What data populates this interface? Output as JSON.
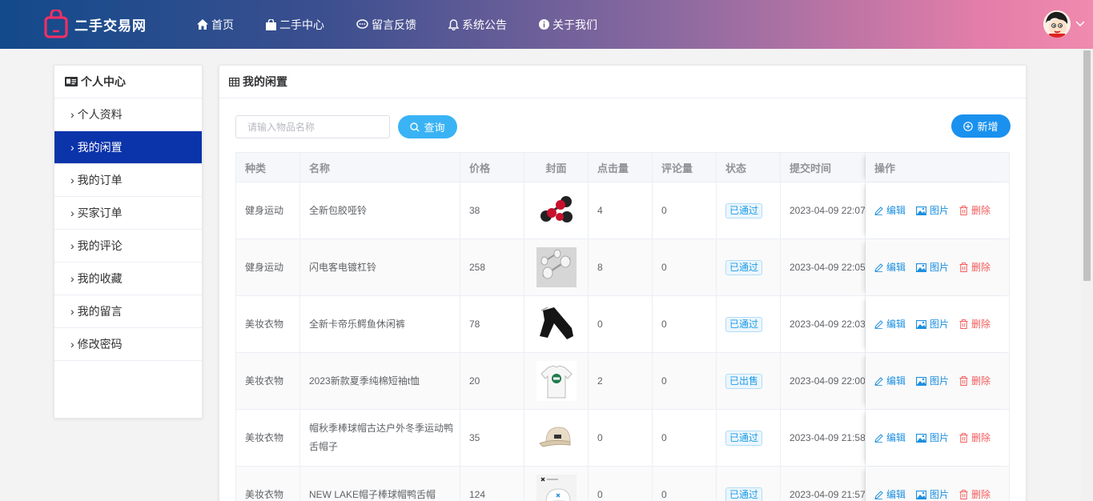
{
  "header": {
    "site_name": "二手交易网",
    "nav": [
      {
        "label": "首页",
        "icon": "home-icon"
      },
      {
        "label": "二手中心",
        "icon": "shopping-bag-icon"
      },
      {
        "label": "留言反馈",
        "icon": "comment-icon"
      },
      {
        "label": "系统公告",
        "icon": "bell-icon"
      },
      {
        "label": "关于我们",
        "icon": "info-icon"
      }
    ]
  },
  "sidebar": {
    "title": "个人中心",
    "items": [
      {
        "label": "个人资料"
      },
      {
        "label": "我的闲置",
        "active": true
      },
      {
        "label": "我的订单"
      },
      {
        "label": "买家订单"
      },
      {
        "label": "我的评论"
      },
      {
        "label": "我的收藏"
      },
      {
        "label": "我的留言"
      },
      {
        "label": "修改密码"
      }
    ]
  },
  "main": {
    "title": "我的闲置",
    "search_placeholder": "请输入物品名称",
    "search_value": "",
    "query_label": "查询",
    "add_label": "新增"
  },
  "table": {
    "columns": [
      "种类",
      "名称",
      "价格",
      "封面",
      "点击量",
      "评论量",
      "状态",
      "提交时间",
      "操作"
    ],
    "rows": [
      {
        "category": "健身运动",
        "name": "全新包胶哑铃",
        "price": "38",
        "cover": "dumbbell",
        "clicks": "4",
        "comments": "0",
        "status": "已通过",
        "time": "2023-04-09 22:07"
      },
      {
        "category": "健身运动",
        "name": "闪电客电镀杠铃",
        "price": "258",
        "cover": "barbell",
        "clicks": "8",
        "comments": "0",
        "status": "已通过",
        "time": "2023-04-09 22:05"
      },
      {
        "category": "美妆衣物",
        "name": "全新卡帝乐鳄鱼休闲裤",
        "price": "78",
        "cover": "pants",
        "clicks": "0",
        "comments": "0",
        "status": "已通过",
        "time": "2023-04-09 22:03"
      },
      {
        "category": "美妆衣物",
        "name": "2023新款夏季纯棉短袖t恤",
        "price": "20",
        "cover": "tshirt",
        "clicks": "2",
        "comments": "0",
        "status": "已出售",
        "time": "2023-04-09 22:00"
      },
      {
        "category": "美妆衣物",
        "name": "帽秋季棒球帽古达户外冬季运动鸭舌帽子",
        "price": "35",
        "cover": "cap",
        "clicks": "0",
        "comments": "0",
        "status": "已通过",
        "time": "2023-04-09 21:58"
      },
      {
        "category": "美妆衣物",
        "name": "NEW LAKE帽子棒球帽鸭舌帽",
        "price": "124",
        "cover": "white-cap",
        "clicks": "0",
        "comments": "0",
        "status": "已通过",
        "time": "2023-04-09 21:57"
      }
    ],
    "actions": {
      "edit": "编辑",
      "picture": "图片",
      "delete": "删除"
    }
  },
  "colors": {
    "accent": "#0b34aa",
    "query": "#3ab3f5",
    "add": "#1a91ee",
    "delete": "#f25b5b"
  }
}
